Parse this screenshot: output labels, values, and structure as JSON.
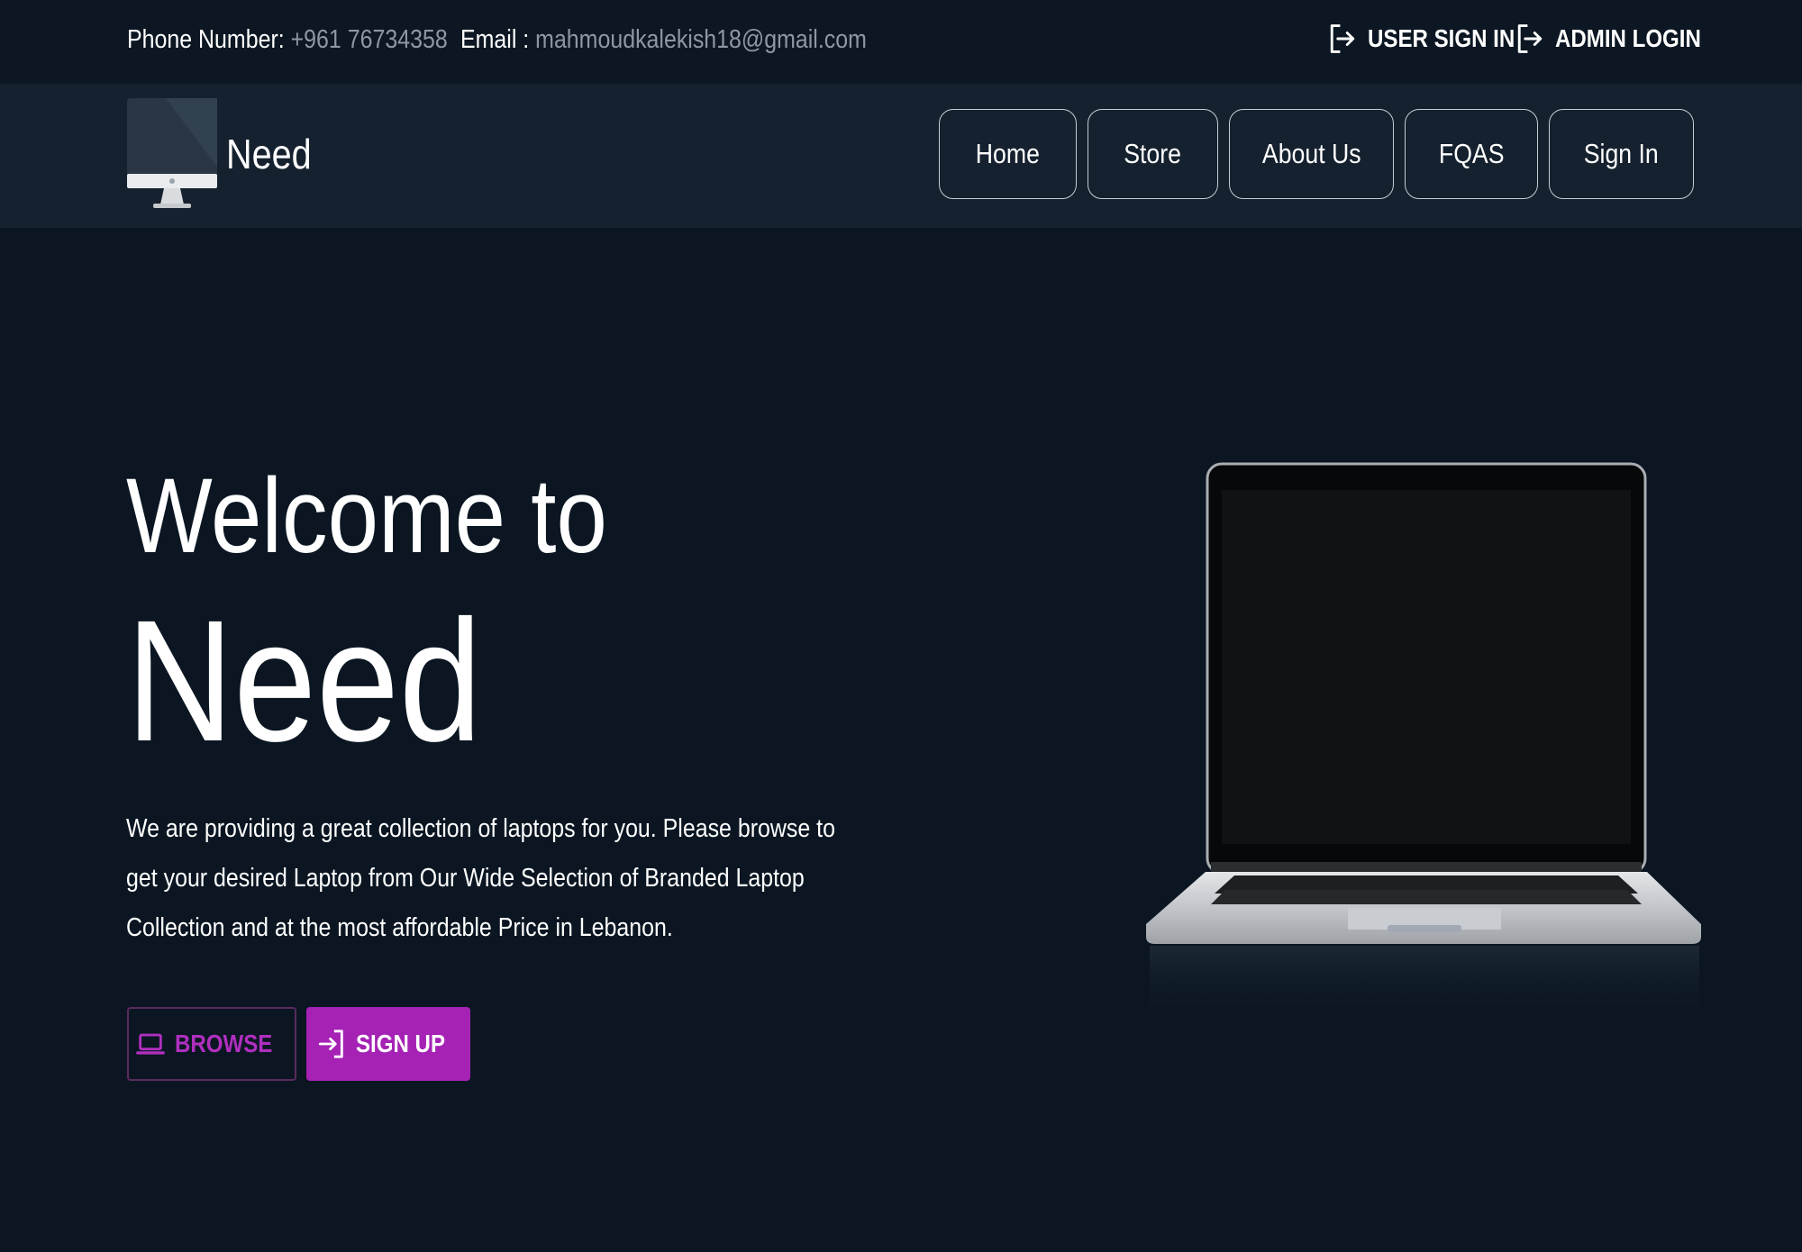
{
  "contact": {
    "phone_label": "Phone Number:",
    "phone_value": "+961 76734358",
    "email_label": "Email :",
    "email_value": "mahmoudkalekish18@gmail.com"
  },
  "auth": {
    "user_sign_in": "USER SIGN IN",
    "admin_login": "ADMIN LOGIN",
    "icon": "sign-out-arrow-icon"
  },
  "brand": {
    "name": "Need",
    "logo_icon": "desktop-monitor-icon"
  },
  "nav": {
    "items": [
      {
        "label": "Home"
      },
      {
        "label": "Store"
      },
      {
        "label": "About Us"
      },
      {
        "label": "FQAS"
      },
      {
        "label": "Sign In"
      }
    ]
  },
  "hero": {
    "welcome": "Welcome to",
    "title": "Need",
    "description": "We are providing a great collection of laptops for you. Please browse to get your desired Laptop from Our Wide Selection of Branded Laptop Collection and at the most affordable Price in Lebanon.",
    "browse_label": "BROWSE",
    "browse_icon": "laptop-icon",
    "signup_label": "SIGN UP",
    "signup_icon": "sign-in-arrow-icon",
    "image": "laptop-image"
  },
  "colors": {
    "background": "#0b1622",
    "topbar": "#0c1723",
    "navbar": "#15212f",
    "accent": "#a522b5",
    "muted_text": "#8e97a4"
  }
}
